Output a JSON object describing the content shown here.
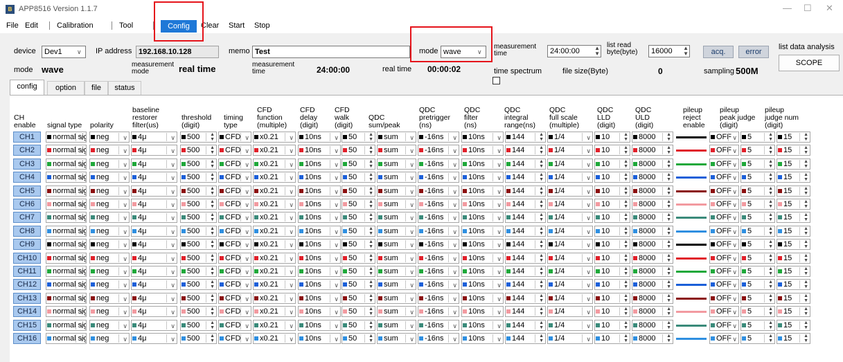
{
  "window": {
    "title": "APP8516   Version 1.1.7",
    "icon": "app-icon"
  },
  "menu": {
    "file": "File",
    "edit": "Edit",
    "calibration": "Calibration",
    "tool": "Tool",
    "config": "Config",
    "clear": "Clear",
    "start": "Start",
    "stop": "Stop"
  },
  "row1": {
    "device_label": "device",
    "device_value": "Dev1",
    "ip_label": "IP address",
    "ip_value": "192.168.10.128",
    "memo_label": "memo",
    "memo_value": "Test",
    "mode_label": "mode",
    "mode_value": "wave",
    "meas_time_label": "measurement time",
    "meas_time_value": "24:00:00",
    "list_read_label": "list read byte(byte)",
    "list_read_value": "16000",
    "acq_button": "acq.",
    "error_button": "error",
    "list_analysis_label": "list data analysis",
    "scope_button": "SCOPE"
  },
  "row2": {
    "mode_label": "mode",
    "mode_value": "wave",
    "meas_mode_label": "measurement mode",
    "meas_mode_value": "real time",
    "meas_time_label": "measurement time",
    "meas_time_value": "24:00:00",
    "real_time_label": "real time",
    "real_time_value": "00:00:02",
    "time_spectrum_label": "time spectrum",
    "file_size_label": "file size(Byte)",
    "file_size_value": "0",
    "sampling_label": "sampling",
    "sampling_value": "500M"
  },
  "tabs": [
    "config",
    "option",
    "file",
    "status"
  ],
  "headers": {
    "ch": [
      "CH",
      "enable"
    ],
    "signal_type": [
      "signal type"
    ],
    "polarity": [
      "polarity"
    ],
    "baseline": [
      "baseline",
      "restorer",
      "filter(us)"
    ],
    "threshold": [
      "threshold",
      "(digit)"
    ],
    "timing": [
      "timing",
      "type"
    ],
    "cfd_function": [
      "CFD",
      "function",
      "(multiple)"
    ],
    "cfd_delay": [
      "CFD",
      "delay",
      "(digit)"
    ],
    "cfd_walk": [
      "CFD",
      "walk",
      "(digit)"
    ],
    "qdc_sum": [
      "QDC",
      "sum/peak"
    ],
    "qdc_pretrigger": [
      "QDC",
      "pretrigger",
      "(ns)"
    ],
    "qdc_filter": [
      "QDC",
      "filter",
      "(ns)"
    ],
    "qdc_integral": [
      "QDC",
      "integral",
      "range(ns)"
    ],
    "qdc_fullscale": [
      "QDC",
      "full scale",
      "(multiple)"
    ],
    "qdc_lld": [
      "QDC",
      "LLD",
      "(digit)"
    ],
    "qdc_uld": [
      "QDC",
      "ULD",
      "(digit)"
    ],
    "pileup_reject": [
      "pileup",
      "reject",
      "enable"
    ],
    "pileup_peak": [
      "pileup",
      "peak judge",
      "(digit)"
    ],
    "pileup_num": [
      "pileup",
      "judge num",
      "(digit)"
    ]
  },
  "channel_defaults": {
    "signal_type": "normal sig",
    "polarity": "neg",
    "baseline": "4μ",
    "threshold": "500",
    "timing": "CFD",
    "cfd_function": "x0.21",
    "cfd_delay": "10ns",
    "cfd_walk": "50",
    "qdc_sum": "sum",
    "qdc_pretrigger": "-16ns",
    "qdc_filter": "10ns",
    "qdc_integral": "144",
    "qdc_fullscale": "1/4",
    "qdc_lld": "10",
    "qdc_uld": "8000",
    "pileup_reject": "OFF",
    "pileup_peak": "5",
    "pileup_num": "15"
  },
  "channels": [
    {
      "name": "CH1",
      "color": "#000000"
    },
    {
      "name": "CH2",
      "color": "#e0202a"
    },
    {
      "name": "CH3",
      "color": "#1fa83a"
    },
    {
      "name": "CH4",
      "color": "#1b5fd8"
    },
    {
      "name": "CH5",
      "color": "#8b1010"
    },
    {
      "name": "CH6",
      "color": "#f29aa0"
    },
    {
      "name": "CH7",
      "color": "#3a8a7a"
    },
    {
      "name": "CH8",
      "color": "#2f8fe0"
    },
    {
      "name": "CH9",
      "color": "#000000"
    },
    {
      "name": "CH10",
      "color": "#e0202a"
    },
    {
      "name": "CH11",
      "color": "#1fa83a"
    },
    {
      "name": "CH12",
      "color": "#1b5fd8"
    },
    {
      "name": "CH13",
      "color": "#8b1010"
    },
    {
      "name": "CH14",
      "color": "#f29aa0"
    },
    {
      "name": "CH15",
      "color": "#3a8a7a"
    },
    {
      "name": "CH16",
      "color": "#2f8fe0"
    }
  ],
  "colors": {
    "accent": "#1e78d7",
    "highlight_box": "#e5141b",
    "ch_button": "#a9c9ef"
  }
}
